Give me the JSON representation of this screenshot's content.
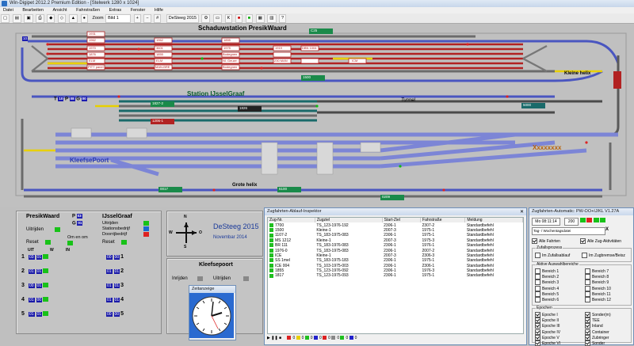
{
  "window": {
    "title": "Win-Digipet 2012.2 Premium Edition - [Stelwerk 1280 x 1024]"
  },
  "menu": [
    "Datei",
    "Bearbeiten",
    "Ansicht",
    "Fahrstraßen",
    "Extras",
    "Fenster",
    "Hilfe"
  ],
  "toolbar": {
    "zoom_label": "Zoom",
    "zoom_value": "Bild 1",
    "layout_name": "DeSteeg 2015",
    "k_label": "K"
  },
  "layout": {
    "station_top": "Schaduwstation  PresikWaard",
    "station_mid": "Station IJsselGraaf",
    "station_kleefse": "KleefsePoort",
    "tunnel": "Tunnel",
    "kleine_helix": "Kleine helix",
    "grote_helix": "Grote helix",
    "xxx": "Xxxxxxxx",
    "block_labels": [
      "TP 009",
      "TP 010",
      "TP 011",
      "TP 012",
      "TP 013",
      "TP 014"
    ],
    "tp_letters": [
      "T",
      "P",
      "G"
    ],
    "num_10": "10",
    "track_tags": [
      "1827-2",
      "1206-1",
      "1826",
      "5000",
      "0017",
      "0209",
      "C25",
      "1500",
      "6100"
    ],
    "top_tags": [
      "1931",
      "1962",
      "1970",
      "1876",
      "PITT panel",
      "ELM",
      "ELM",
      "MAN-BRE",
      "1962",
      "3601",
      "1855",
      "Nl. Geuze",
      "Bodegnen",
      "1855",
      "1975",
      "Bodegnen",
      "1919",
      "230 MAN",
      "ICM",
      "DBN 1004"
    ]
  },
  "panel": {
    "presik": {
      "title": "PresikWaard",
      "uitrijden": "Uitrijden",
      "reset": "Reset",
      "om_en_om": "Om en om",
      "uit": "UIT",
      "w": "W",
      "in": "IN",
      "p": "P",
      "g": "G",
      "p_val": "03",
      "g_val": "01"
    },
    "ijssel": {
      "title": "IJsselGraaf",
      "uitrijden": "Uitrijden",
      "station": "Stationsbedrijf",
      "doorrij": "Doorrijbedrijf",
      "reset": "Reset"
    },
    "rows": [
      "1",
      "2",
      "3",
      "4",
      "5"
    ],
    "rows_right": [
      "1",
      "2",
      "3",
      "4",
      "5"
    ],
    "compass": {
      "n": "N",
      "s": "S",
      "w": "W",
      "o": "O"
    },
    "brand": {
      "title": "DeSteeg 2015",
      "subtitle": "Novembar  2014"
    },
    "kleef": {
      "title": "Kleefsepoort",
      "inrijden": "Inrijden",
      "uitrijden": "Uitrijden"
    },
    "clock_title": "Zeitanzeige"
  },
  "inspector": {
    "title": "Zugfahrten-Ablauf-Inspektor",
    "columns": [
      "Zug-Nr.",
      "Zugziel",
      "Start-Ziel",
      "Fahrstraße",
      "Meldung"
    ],
    "rows": [
      [
        "7700",
        "TS_123-1976-192",
        "2306-1",
        "2307-2",
        "Standardbefehl"
      ],
      [
        "1500",
        "Kleine-1",
        "2007-3",
        "1975-1",
        "Standardbefehl"
      ],
      [
        "1107-2",
        "TS_183-1975-083",
        "2306-1",
        "1975-1",
        "Standardbefehl"
      ],
      [
        "MS 1212",
        "Kleine-1",
        "2007-3",
        "1975-3",
        "Standardbefehl"
      ],
      [
        "BR 111",
        "TS_183-1976-083",
        "2306-1",
        "1976-1",
        "Standardbefehl"
      ],
      [
        "1976-0",
        "TS_183-1975-083",
        "2306-1",
        "2007-2",
        "Standardbefehl"
      ],
      [
        "ICE",
        "Kleine-1",
        "2007-3",
        "2306-3",
        "Standardbefehl"
      ],
      [
        "SS 1mel",
        "TS_183-1975-183",
        "2306-1",
        "1975-1",
        "Standardbefehl"
      ],
      [
        "ICE 004",
        "TS_103-1975-003",
        "2306-1",
        "2306-1",
        "Standardbefehl"
      ],
      [
        "1855",
        "TS_123-1976-092",
        "2306-1",
        "1976-3",
        "Standardbefehl"
      ],
      [
        "1817",
        "TS_123-1975-093",
        "2306-1",
        "1975-1",
        "Standardbefehl"
      ]
    ],
    "footer_counts": [
      "0",
      "0",
      "0",
      "0",
      "0",
      "0",
      "0",
      "0"
    ]
  },
  "automatic": {
    "title": "Zugfahrten-Automatic: PW-OO+IJ/KL V1.27A",
    "time": "Mo  08:11:14",
    "speed": "200",
    "dropdown": "Tag- / Wochentagsdatei",
    "x_label": "X",
    "check_alle_fahrten": "Alle Fahrten",
    "check_alle_zug": "Alle Zug-Aktivitäten",
    "group_zufall": "Zufallsprozess",
    "opt_zufall": "Im Zufallsablauf",
    "opt_zugbremse": "Im Zugbremse/Beisz",
    "group_zeit": "Aktive Auswahlbereiche",
    "left_opts": [
      "Bereich 1",
      "Bereich 2",
      "Bereich 3",
      "Bereich 4",
      "Bereich 5",
      "Bereich 6"
    ],
    "right_opts": [
      "Bereich 7",
      "Bereich 8",
      "Bereich 9",
      "Bereich 10",
      "Bereich 11",
      "Bereich 12"
    ],
    "group_epoch": "Epochen",
    "epoch_left": [
      "Epoche I",
      "Epoche II",
      "Epoche III",
      "Epoche IV",
      "Epoche V",
      "Epoche VI"
    ],
    "epoch_right": [
      "Sonder(m)",
      "TEE",
      "Inland",
      "Container",
      "Zubringer",
      "Sonder"
    ]
  }
}
